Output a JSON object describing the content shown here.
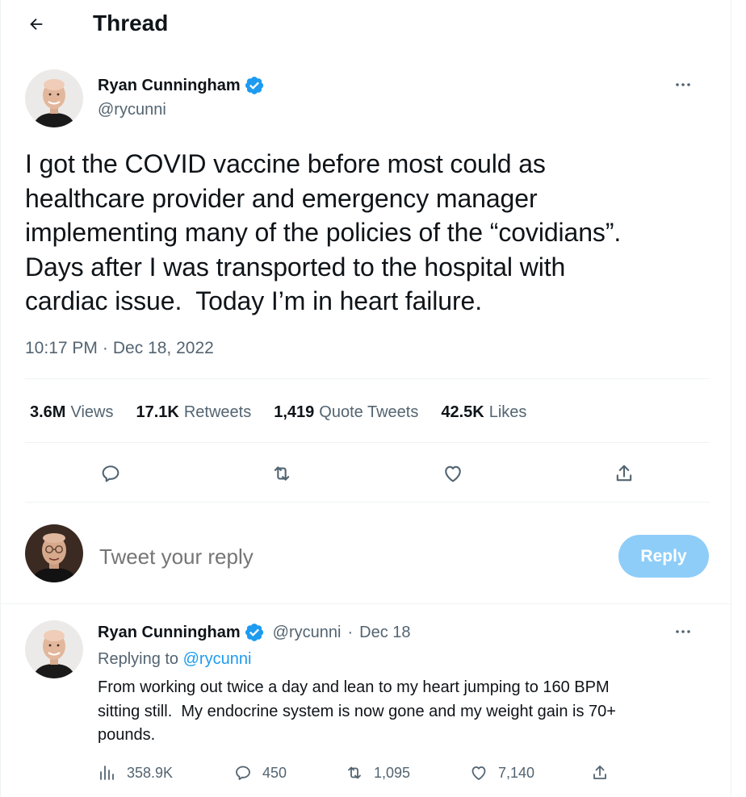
{
  "header": {
    "title": "Thread"
  },
  "main_tweet": {
    "author_name": "Ryan Cunningham",
    "author_handle": "@rycunni",
    "text": "I got the COVID vaccine before most could as\nhealthcare provider and emergency manager\nimplementing many of the policies of the “covidians”.\nDays after I was transported to the hospital with\ncardiac issue.  Today I’m in heart failure.",
    "time": "10:17 PM",
    "separator": "·",
    "date": "Dec 18, 2022",
    "stats": [
      {
        "value": "3.6M",
        "label": "Views"
      },
      {
        "value": "17.1K",
        "label": "Retweets"
      },
      {
        "value": "1,419",
        "label": "Quote Tweets"
      },
      {
        "value": "42.5K",
        "label": "Likes"
      }
    ],
    "action_icons": [
      "reply-icon",
      "retweet-icon",
      "like-icon",
      "share-icon"
    ]
  },
  "composer": {
    "placeholder": "Tweet your reply",
    "button_label": "Reply"
  },
  "reply_tweet": {
    "author_name": "Ryan Cunningham",
    "author_handle": "@rycunni",
    "separator": "·",
    "date": "Dec 18",
    "replying_prefix": "Replying to",
    "replying_to": "@rycunni",
    "text": "From working out twice a day and lean to my heart jumping to 160 BPM\nsitting still.  My endocrine system is now gone and my weight gain is 70+\npounds.",
    "counts": {
      "views": "358.9K",
      "replies": "450",
      "retweets": "1,095",
      "likes": "7,140"
    }
  },
  "colors": {
    "text": "#0f1419",
    "secondary": "#536471",
    "accent": "#1d9bf0",
    "reply_button_disabled": "#8ecdf8",
    "divider": "#eff3f4"
  }
}
